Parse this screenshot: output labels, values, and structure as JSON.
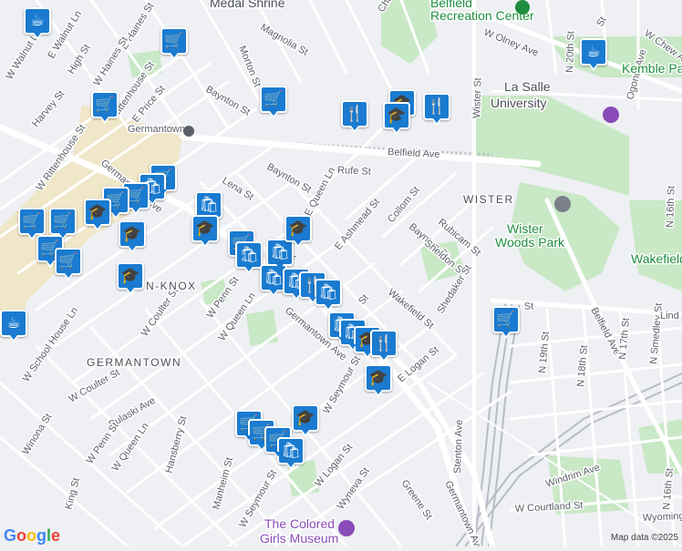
{
  "map": {
    "colors": {
      "background": "#eef0f3",
      "road": "#ffffff",
      "park": "#c9e8c6",
      "campus": "#f0e6c8",
      "rail": "#b8bcc4",
      "label": "#5b6068",
      "pin": "#1a7bd0",
      "poi_purple": "#8a4bb8",
      "poi_green": "#1e8e3e"
    },
    "places": {
      "belfield_rec": "Belfield\nRecreation Center",
      "la_salle": "La Salle\nUniversity",
      "wister_woods": "Wister\nWoods Park",
      "kemble_park": "Kemble Park",
      "wakefield_park": "Wakefield",
      "colored_girls": "The Colored\nGirls Museum",
      "medal_shrine": "Medal Shrine",
      "germantown_station": "Germantown"
    },
    "neighborhoods": [
      "WISTER",
      "N-KNOX",
      "GERMANTOWN"
    ],
    "streets": [
      "W Walnut Ln",
      "E Walnut Ln",
      "High St",
      "E Haines St",
      "W Haines St",
      "Magnolia St",
      "Morton St",
      "Harvey St",
      "E Price St",
      "Rittenhouse St",
      "W Rittenhouse St",
      "Baynton St",
      "Belfield Ave",
      "Rufe St",
      "Lena St",
      "E Queen Ln",
      "E Ashmead St",
      "Collom St",
      "Rubicam St",
      "Sheldon St",
      "Shedaker St",
      "Wakefield St",
      "W Penn St",
      "W Queen Ln",
      "W Coulter St",
      "W School House Ln",
      "Winona St",
      "Pulaski Ave",
      "W Seymour St",
      "E Logan St",
      "W Logan St",
      "Wyneva St",
      "Greene St",
      "Stenton Ave",
      "Germantown Ave",
      "Manheim St",
      "Hansberry St",
      "King St",
      "Windrim Ave",
      "W Courtland St",
      "Wyoming",
      "N 19th St",
      "N 18th St",
      "N 17th St",
      "N Smedley St",
      "N 16th St",
      "W Olney Ave",
      "Wister St",
      "N 20th St",
      "W Chew Ave",
      "Ogontz Ave",
      "Church",
      "Lind",
      "Kemble",
      "Ch",
      "St"
    ],
    "attribution": "Map data ©2025",
    "logo": "Google"
  }
}
